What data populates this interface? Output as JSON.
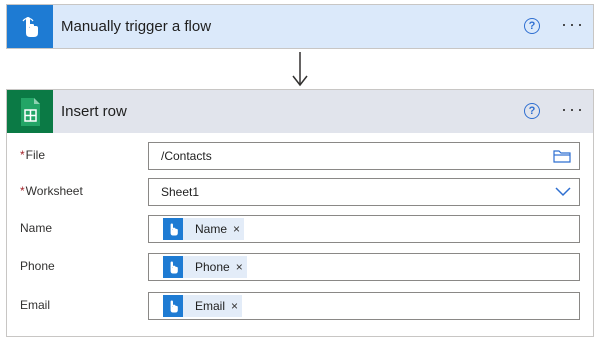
{
  "trigger": {
    "title": "Manually trigger a flow",
    "help_label": "?",
    "more_label": "···",
    "icon": "touch-hand-icon",
    "accent": "#1e7bd3"
  },
  "action": {
    "title": "Insert row",
    "help_label": "?",
    "more_label": "···",
    "icon": "google-sheets-icon",
    "accent": "#0b7a45"
  },
  "fields": {
    "file": {
      "required_mark": "*",
      "label": "File",
      "value": "/Contacts",
      "icon": "folder-icon"
    },
    "worksheet": {
      "required_mark": "*",
      "label": "Worksheet",
      "value": "Sheet1",
      "icon": "chevron-down-icon"
    },
    "name": {
      "label": "Name",
      "token": "Name",
      "remove": "×"
    },
    "phone": {
      "label": "Phone",
      "token": "Phone",
      "remove": "×"
    },
    "email": {
      "label": "Email",
      "token": "Email",
      "remove": "×"
    }
  }
}
